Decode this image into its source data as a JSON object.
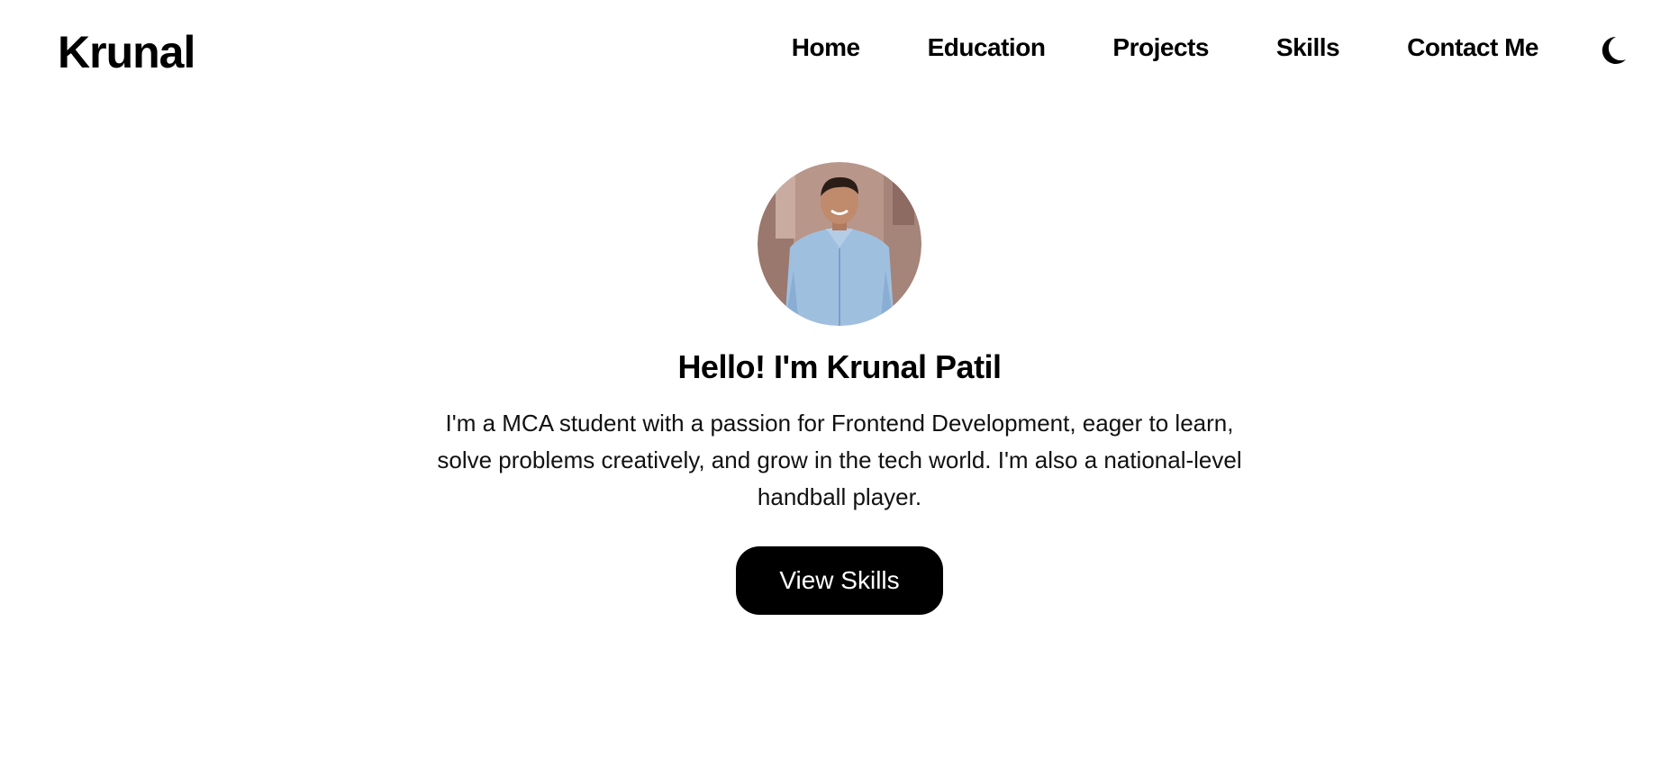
{
  "brand": {
    "name": "Krunal"
  },
  "nav": {
    "items": [
      {
        "label": "Home"
      },
      {
        "label": "Education"
      },
      {
        "label": "Projects"
      },
      {
        "label": "Skills"
      },
      {
        "label": "Contact Me"
      }
    ],
    "theme_toggle_icon": "moon-icon"
  },
  "hero": {
    "avatar_icon": "profile-photo",
    "greeting": "Hello! I'm Krunal Patil",
    "intro": "I'm a MCA student with a passion for Frontend Development, eager to learn, solve problems creatively, and grow in the tech world. I'm also a national-level handball player.",
    "cta_label": "View Skills"
  },
  "colors": {
    "background": "#ffffff",
    "text": "#000000",
    "button_bg": "#000000",
    "button_text": "#ffffff"
  }
}
